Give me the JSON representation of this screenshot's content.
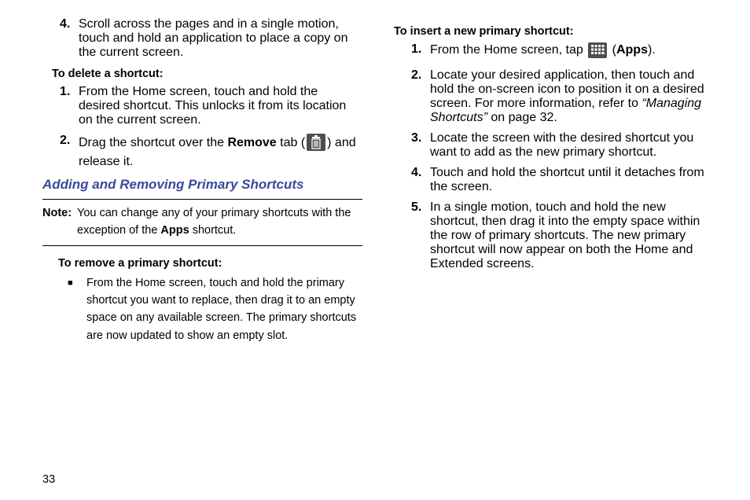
{
  "page_number": "33",
  "left": {
    "step4_num": "4.",
    "step4_text": "Scroll across the pages and in a single motion, touch and hold an application to place a copy on the current screen.",
    "delete_head": "To delete a shortcut:",
    "del1_num": "1.",
    "del1_text": "From the Home screen, touch and hold the desired shortcut. This unlocks it from its location on the current screen.",
    "del2_num": "2.",
    "del2_pre": "Drag the shortcut over the ",
    "del2_bold": "Remove",
    "del2_mid": " tab (",
    "del2_post": ") and release it.",
    "section_title": "Adding and Removing Primary Shortcuts",
    "note_label": "Note:",
    "note_a": "You can change any of your primary shortcuts with the exception of the ",
    "note_bold": "Apps",
    "note_b": " shortcut.",
    "remove_head": "To remove a primary shortcut:",
    "remove_bullet": "From the Home screen, touch and hold the primary shortcut you want to replace, then drag it to an empty space on any available screen. The primary shortcuts are now updated to show an empty slot."
  },
  "right": {
    "insert_head": "To insert a new primary shortcut:",
    "i1_num": "1.",
    "i1_a": "From the Home screen, tap ",
    "i1_mid": " (",
    "i1_bold": "Apps",
    "i1_b": ").",
    "i2_num": "2.",
    "i2_a": "Locate your desired application, then touch and hold the on-screen icon to position it on a desired screen. For more information, refer to ",
    "i2_ital": "“Managing Shortcuts”",
    "i2_b": " on page 32.",
    "i3_num": "3.",
    "i3_text": "Locate the screen with the desired shortcut you want to add as the new primary shortcut.",
    "i4_num": "4.",
    "i4_text": "Touch and hold the shortcut until it detaches from the screen.",
    "i5_num": "5.",
    "i5_text": "In a single motion, touch and hold the new shortcut, then drag it into the empty space within the row of primary shortcuts. The new primary shortcut will now appear on both the Home and Extended screens."
  }
}
